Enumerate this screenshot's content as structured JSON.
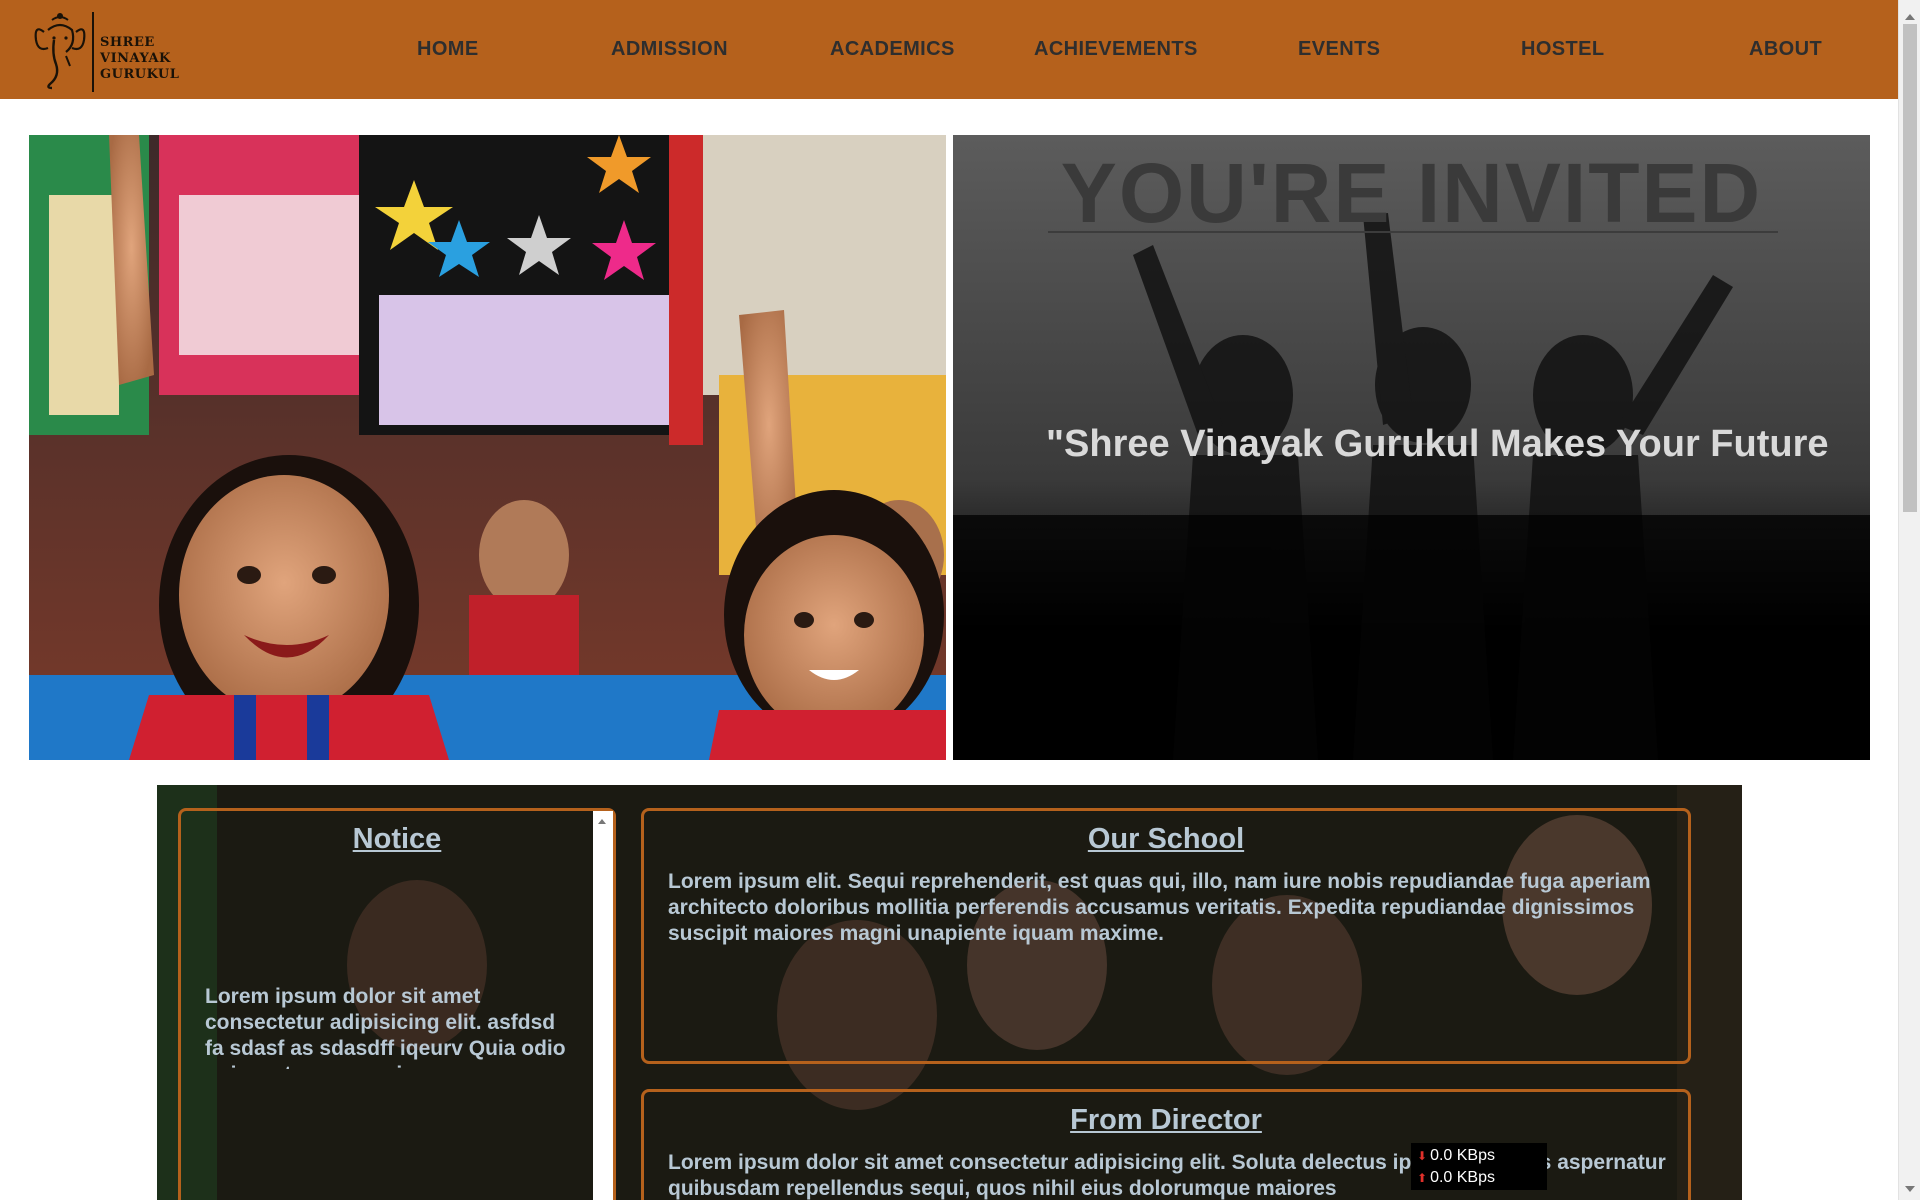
{
  "brand": {
    "line1": "SHREE VINAYAK",
    "line2": "GURUKUL"
  },
  "nav": {
    "items": [
      "HOME",
      "ADMISSION",
      "ACADEMICS",
      "ACHIEVEMENTS",
      "EVENTS",
      "HOSTEL",
      "ABOUT"
    ]
  },
  "hero": {
    "invited": "YOU'RE INVITED",
    "tagline": "\"Shree Vinayak Gurukul Makes Your Future"
  },
  "notice": {
    "title": "Notice",
    "text": "Lorem ipsum dolor sit amet consectetur adipisicing elit. asfdsd fa sdasf as sdasdff iqeurv Quia odio qui amet rem nam, iure"
  },
  "our_school": {
    "title": "Our School",
    "text": "Lorem ipsum elit. Sequi reprehenderit, est quas qui, illo, nam iure nobis repudiandae fuga aperiam architecto doloribus mollitia perferendis accusamus veritatis. Expedita repudiandae dignissimos suscipit maiores magni unapiente iquam maxime."
  },
  "director": {
    "title": "From Director",
    "text": "Lorem ipsum dolor sit amet consectetur adipisicing elit. Soluta delectus ipsam sit minus aspernatur quibusdam repellendus sequi, quos nihil eius dolorumque maiores"
  },
  "network": {
    "down": "0.0 KBps",
    "up": "0.0 KBps"
  },
  "colors": {
    "nav_bg": "#b5611c",
    "panel_border": "#b5611c",
    "panel_text": "#b8c8d4"
  }
}
